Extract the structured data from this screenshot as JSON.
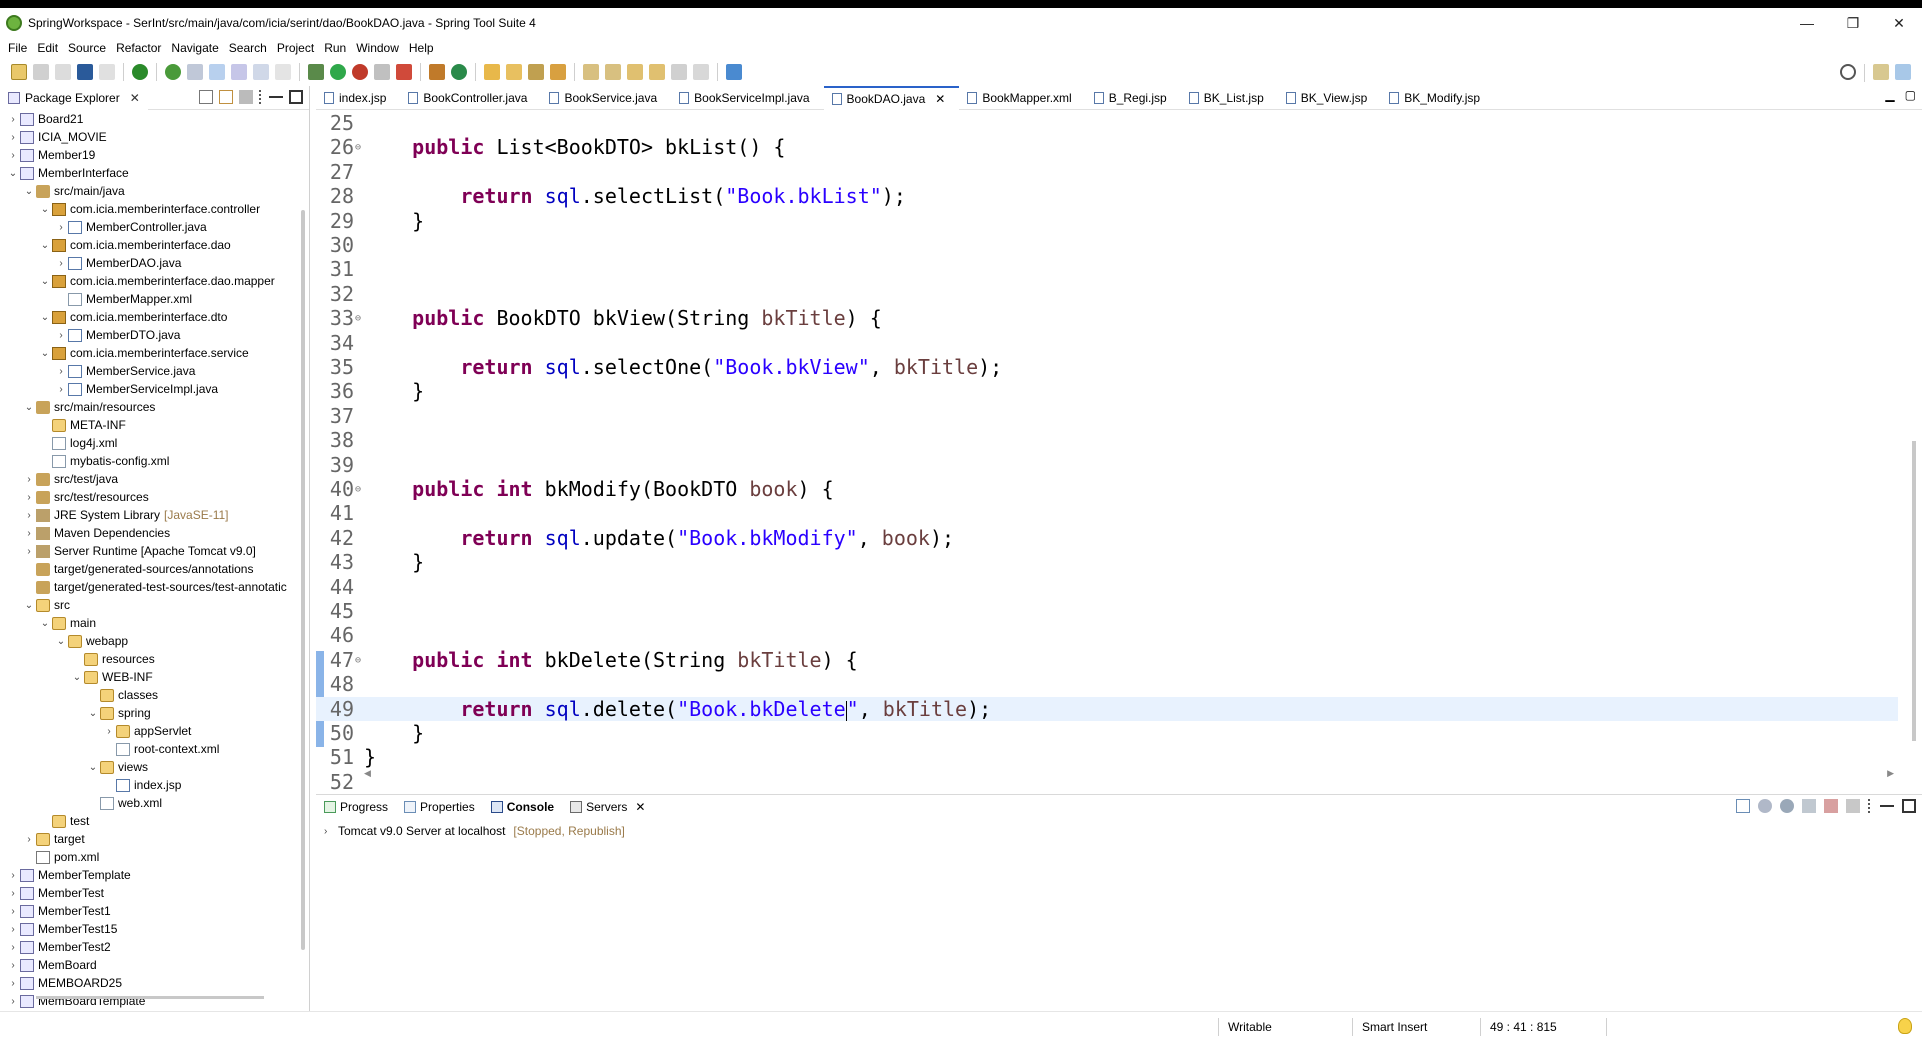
{
  "window": {
    "title": "SpringWorkspace - SerInt/src/main/java/com/icia/serint/dao/BookDAO.java - Spring Tool Suite 4",
    "controls": [
      "—",
      "❐",
      "✕"
    ]
  },
  "menu": [
    "File",
    "Edit",
    "Source",
    "Refactor",
    "Navigate",
    "Search",
    "Project",
    "Run",
    "Window",
    "Help"
  ],
  "package_explorer": {
    "title": "Package Explorer",
    "tree": [
      {
        "label": "Board21",
        "type": "proj",
        "indent": 0,
        "expanded": false
      },
      {
        "label": "ICIA_MOVIE",
        "type": "proj",
        "indent": 0,
        "expanded": false
      },
      {
        "label": "Member19",
        "type": "proj",
        "indent": 0,
        "expanded": false
      },
      {
        "label": "MemberInterface",
        "type": "proj",
        "indent": 0,
        "expanded": true
      },
      {
        "label": "src/main/java",
        "type": "pkgroot",
        "indent": 1,
        "expanded": true
      },
      {
        "label": "com.icia.memberinterface.controller",
        "type": "pkg",
        "indent": 2,
        "expanded": true
      },
      {
        "label": "MemberController.java",
        "type": "java",
        "indent": 3,
        "expanded": false
      },
      {
        "label": "com.icia.memberinterface.dao",
        "type": "pkg",
        "indent": 2,
        "expanded": true
      },
      {
        "label": "MemberDAO.java",
        "type": "java",
        "indent": 3,
        "expanded": false
      },
      {
        "label": "com.icia.memberinterface.dao.mapper",
        "type": "pkg",
        "indent": 2,
        "expanded": true
      },
      {
        "label": "MemberMapper.xml",
        "type": "xml",
        "indent": 3,
        "expanded": null
      },
      {
        "label": "com.icia.memberinterface.dto",
        "type": "pkg",
        "indent": 2,
        "expanded": true
      },
      {
        "label": "MemberDTO.java",
        "type": "java",
        "indent": 3,
        "expanded": false
      },
      {
        "label": "com.icia.memberinterface.service",
        "type": "pkg",
        "indent": 2,
        "expanded": true
      },
      {
        "label": "MemberService.java",
        "type": "java",
        "indent": 3,
        "expanded": false
      },
      {
        "label": "MemberServiceImpl.java",
        "type": "java",
        "indent": 3,
        "expanded": false
      },
      {
        "label": "src/main/resources",
        "type": "pkgroot",
        "indent": 1,
        "expanded": true
      },
      {
        "label": "META-INF",
        "type": "folder",
        "indent": 2,
        "expanded": null
      },
      {
        "label": "log4j.xml",
        "type": "xml",
        "indent": 2,
        "expanded": null
      },
      {
        "label": "mybatis-config.xml",
        "type": "xml",
        "indent": 2,
        "expanded": null
      },
      {
        "label": "src/test/java",
        "type": "pkgroot",
        "indent": 1,
        "expanded": false
      },
      {
        "label": "src/test/resources",
        "type": "pkgroot",
        "indent": 1,
        "expanded": false
      },
      {
        "label": "JRE System Library",
        "suffix": "[JavaSE-11]",
        "type": "lib",
        "indent": 1,
        "expanded": false
      },
      {
        "label": "Maven Dependencies",
        "type": "lib",
        "indent": 1,
        "expanded": false
      },
      {
        "label": "Server Runtime [Apache Tomcat v9.0]",
        "type": "lib",
        "indent": 1,
        "expanded": false
      },
      {
        "label": "target/generated-sources/annotations",
        "type": "pkgroot",
        "indent": 1,
        "expanded": null
      },
      {
        "label": "target/generated-test-sources/test-annotatic",
        "type": "pkgroot",
        "indent": 1,
        "expanded": null
      },
      {
        "label": "src",
        "type": "folder",
        "indent": 1,
        "expanded": true
      },
      {
        "label": "main",
        "type": "folder",
        "indent": 2,
        "expanded": true
      },
      {
        "label": "webapp",
        "type": "folder",
        "indent": 3,
        "expanded": true
      },
      {
        "label": "resources",
        "type": "folder",
        "indent": 4,
        "expanded": null
      },
      {
        "label": "WEB-INF",
        "type": "folder",
        "indent": 4,
        "expanded": true
      },
      {
        "label": "classes",
        "type": "folder",
        "indent": 5,
        "expanded": null
      },
      {
        "label": "spring",
        "type": "folder",
        "indent": 5,
        "expanded": true
      },
      {
        "label": "appServlet",
        "type": "folder",
        "indent": 6,
        "expanded": false
      },
      {
        "label": "root-context.xml",
        "type": "xml",
        "indent": 6,
        "expanded": null
      },
      {
        "label": "views",
        "type": "folder",
        "indent": 5,
        "expanded": true
      },
      {
        "label": "index.jsp",
        "type": "java",
        "indent": 6,
        "expanded": null
      },
      {
        "label": "web.xml",
        "type": "xml",
        "indent": 5,
        "expanded": null
      },
      {
        "label": "test",
        "type": "folder",
        "indent": 2,
        "expanded": null
      },
      {
        "label": "target",
        "type": "folder",
        "indent": 1,
        "expanded": false
      },
      {
        "label": "pom.xml",
        "type": "pom",
        "indent": 1,
        "expanded": null
      },
      {
        "label": "MemberTemplate",
        "type": "proj",
        "indent": 0,
        "expanded": false
      },
      {
        "label": "MemberTest",
        "type": "proj",
        "indent": 0,
        "expanded": false
      },
      {
        "label": "MemberTest1",
        "type": "proj",
        "indent": 0,
        "expanded": false
      },
      {
        "label": "MemberTest15",
        "type": "proj",
        "indent": 0,
        "expanded": false
      },
      {
        "label": "MemberTest2",
        "type": "proj",
        "indent": 0,
        "expanded": false
      },
      {
        "label": "MemBoard",
        "type": "proj",
        "indent": 0,
        "expanded": false
      },
      {
        "label": "MEMBOARD25",
        "type": "proj",
        "indent": 0,
        "expanded": false
      },
      {
        "label": "MemBoardTemplate",
        "type": "proj",
        "indent": 0,
        "expanded": false
      }
    ]
  },
  "editor": {
    "tabs": [
      {
        "label": "index.jsp",
        "active": false
      },
      {
        "label": "BookController.java",
        "active": false
      },
      {
        "label": "BookService.java",
        "active": false
      },
      {
        "label": "BookServiceImpl.java",
        "active": false
      },
      {
        "label": "BookDAO.java",
        "active": true
      },
      {
        "label": "BookMapper.xml",
        "active": false
      },
      {
        "label": "B_Regi.jsp",
        "active": false
      },
      {
        "label": "BK_List.jsp",
        "active": false
      },
      {
        "label": "BK_View.jsp",
        "active": false
      },
      {
        "label": "BK_Modify.jsp",
        "active": false
      }
    ],
    "lines": [
      {
        "n": "25",
        "fold": "",
        "tokens": []
      },
      {
        "n": "26",
        "fold": "⊖",
        "tokens": [
          [
            "    ",
            ""
          ],
          [
            "public",
            "kw"
          ],
          [
            " List<BookDTO> bkList() {",
            ""
          ]
        ]
      },
      {
        "n": "27",
        "fold": "",
        "tokens": []
      },
      {
        "n": "28",
        "fold": "",
        "tokens": [
          [
            "        ",
            ""
          ],
          [
            "return",
            "kw"
          ],
          [
            " ",
            ""
          ],
          [
            "sql",
            "fld"
          ],
          [
            ".selectList(",
            ""
          ],
          [
            "\"Book.bkList\"",
            "str"
          ],
          [
            ");",
            ""
          ]
        ]
      },
      {
        "n": "29",
        "fold": "",
        "tokens": [
          [
            "    }",
            ""
          ]
        ]
      },
      {
        "n": "30",
        "fold": "",
        "tokens": []
      },
      {
        "n": "31",
        "fold": "",
        "tokens": []
      },
      {
        "n": "32",
        "fold": "",
        "tokens": []
      },
      {
        "n": "33",
        "fold": "⊖",
        "tokens": [
          [
            "    ",
            ""
          ],
          [
            "public",
            "kw"
          ],
          [
            " BookDTO bkView(String ",
            ""
          ],
          [
            "bkTitle",
            "par"
          ],
          [
            ") {",
            ""
          ]
        ]
      },
      {
        "n": "34",
        "fold": "",
        "tokens": []
      },
      {
        "n": "35",
        "fold": "",
        "tokens": [
          [
            "        ",
            ""
          ],
          [
            "return",
            "kw"
          ],
          [
            " ",
            ""
          ],
          [
            "sql",
            "fld"
          ],
          [
            ".selectOne(",
            ""
          ],
          [
            "\"Book.bkView\"",
            "str"
          ],
          [
            ", ",
            ""
          ],
          [
            "bkTitle",
            "par"
          ],
          [
            ");",
            ""
          ]
        ]
      },
      {
        "n": "36",
        "fold": "",
        "tokens": [
          [
            "    }",
            ""
          ]
        ]
      },
      {
        "n": "37",
        "fold": "",
        "tokens": []
      },
      {
        "n": "38",
        "fold": "",
        "tokens": []
      },
      {
        "n": "39",
        "fold": "",
        "tokens": []
      },
      {
        "n": "40",
        "fold": "⊖",
        "tokens": [
          [
            "    ",
            ""
          ],
          [
            "public",
            "kw"
          ],
          [
            " ",
            ""
          ],
          [
            "int",
            "kw"
          ],
          [
            " bkModify(BookDTO ",
            ""
          ],
          [
            "book",
            "par"
          ],
          [
            ") {",
            ""
          ]
        ]
      },
      {
        "n": "41",
        "fold": "",
        "tokens": []
      },
      {
        "n": "42",
        "fold": "",
        "tokens": [
          [
            "        ",
            ""
          ],
          [
            "return",
            "kw"
          ],
          [
            " ",
            ""
          ],
          [
            "sql",
            "fld"
          ],
          [
            ".update(",
            ""
          ],
          [
            "\"Book.bkModify\"",
            "str"
          ],
          [
            ", ",
            ""
          ],
          [
            "book",
            "par"
          ],
          [
            ");",
            ""
          ]
        ]
      },
      {
        "n": "43",
        "fold": "",
        "tokens": [
          [
            "    }",
            ""
          ]
        ]
      },
      {
        "n": "44",
        "fold": "",
        "tokens": []
      },
      {
        "n": "45",
        "fold": "",
        "tokens": []
      },
      {
        "n": "46",
        "fold": "",
        "tokens": []
      },
      {
        "n": "47",
        "fold": "⊖",
        "tokens": [
          [
            "    ",
            ""
          ],
          [
            "public",
            "kw"
          ],
          [
            " ",
            ""
          ],
          [
            "int",
            "kw"
          ],
          [
            " bkDelete(String ",
            ""
          ],
          [
            "bkTitle",
            "par"
          ],
          [
            ") {",
            ""
          ]
        ]
      },
      {
        "n": "48",
        "fold": "",
        "tokens": []
      },
      {
        "n": "49",
        "fold": "",
        "current": true,
        "tokens": [
          [
            "        ",
            ""
          ],
          [
            "return",
            "kw"
          ],
          [
            " ",
            ""
          ],
          [
            "sql",
            "fld"
          ],
          [
            ".delete(",
            ""
          ],
          [
            "\"Book.bkDelete",
            "str"
          ],
          [
            "|caret|",
            "caret"
          ],
          [
            "\"",
            "str"
          ],
          [
            ", ",
            ""
          ],
          [
            "bkTitle",
            "par"
          ],
          [
            ");",
            ""
          ]
        ]
      },
      {
        "n": "50",
        "fold": "",
        "tokens": [
          [
            "    }",
            ""
          ]
        ]
      },
      {
        "n": "51",
        "fold": "",
        "tokens": [
          [
            "}",
            ""
          ]
        ]
      },
      {
        "n": "52",
        "fold": "",
        "tokens": []
      }
    ]
  },
  "bottom_panel": {
    "tabs": [
      {
        "label": "Progress",
        "active": false
      },
      {
        "label": "Properties",
        "active": false
      },
      {
        "label": "Console",
        "active": true
      },
      {
        "label": "Servers",
        "active": false,
        "closable": true
      }
    ],
    "server": {
      "name": "Tomcat v9.0 Server at localhost",
      "status": "[Stopped, Republish]"
    }
  },
  "status_bar": {
    "mode": "Writable",
    "insert": "Smart Insert",
    "position": "49 : 41 : 815"
  },
  "colors": {
    "keyword": "#7f0055",
    "string": "#2a00ff",
    "field": "#0000c0",
    "param": "#6a3e3e",
    "current_line": "#e8f2fe"
  }
}
